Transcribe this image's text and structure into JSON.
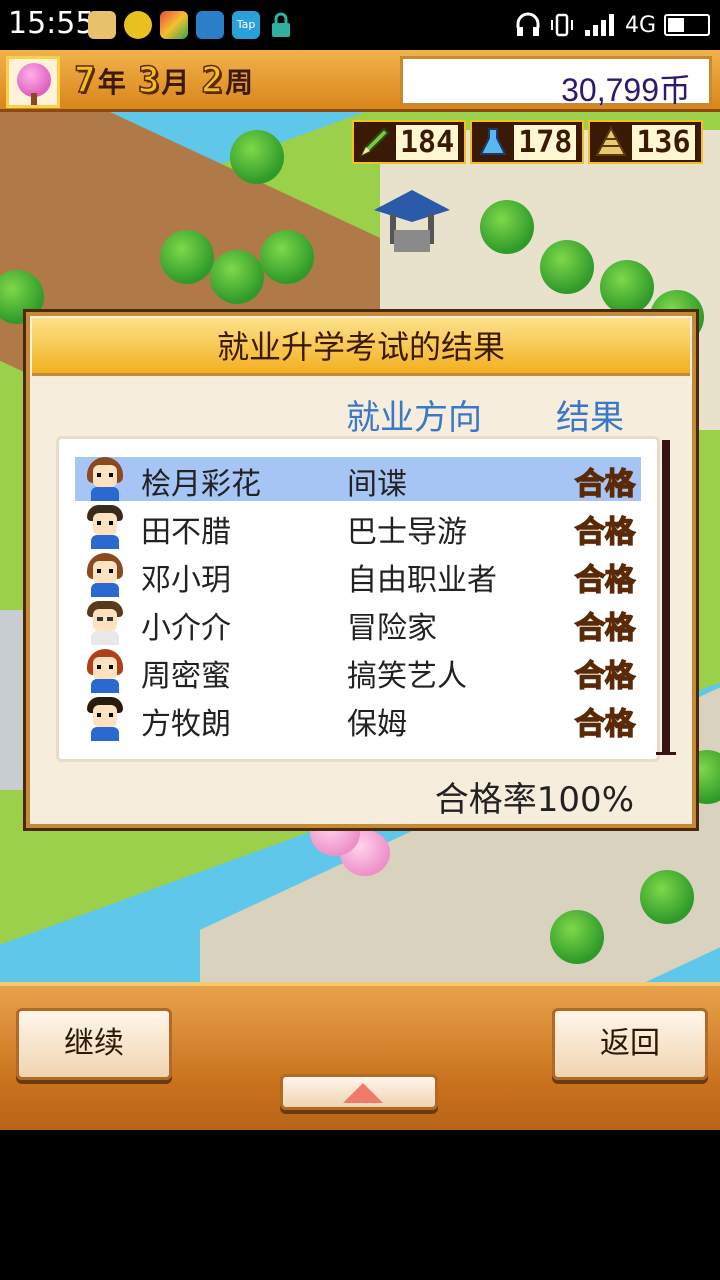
{
  "status_bar": {
    "time": "15:55",
    "network": "4G",
    "icons": [
      "app-icon",
      "app-icon",
      "app-icon",
      "scan-icon",
      "tap-icon",
      "lock-icon",
      "headphones-icon",
      "vibrate-icon",
      "signal-icon",
      "battery-icon"
    ],
    "tap_label": "Tap"
  },
  "top_bar": {
    "year": "7",
    "year_unit": "年",
    "month": "3",
    "month_unit": "月",
    "week": "2",
    "week_unit": "周",
    "money": "30,799币"
  },
  "stats": [
    {
      "icon": "pencil-icon",
      "value": "184"
    },
    {
      "icon": "flask-icon",
      "value": "178"
    },
    {
      "icon": "pyramid-icon",
      "value": "136"
    }
  ],
  "dialog": {
    "title": "就业升学考试的结果",
    "col_direction": "就业方向",
    "col_result": "结果",
    "rows": [
      {
        "name": "桧月彩花",
        "direction": "间谍",
        "result": "合格",
        "selected": true
      },
      {
        "name": "田不腊",
        "direction": "巴士导游",
        "result": "合格"
      },
      {
        "name": "邓小玥",
        "direction": "自由职业者",
        "result": "合格"
      },
      {
        "name": "小介介",
        "direction": "冒险家",
        "result": "合格"
      },
      {
        "name": "周密蜜",
        "direction": "搞笑艺人",
        "result": "合格"
      },
      {
        "name": "方牧朗",
        "direction": "保姆",
        "result": "合格"
      }
    ],
    "pass_rate": "合格率100%"
  },
  "buttons": {
    "continue": "继续",
    "back": "返回"
  },
  "colors": {
    "header_blue": "#3a78c8",
    "selected_row": "#a6c4f4",
    "pass_gold": "#f4a020"
  }
}
